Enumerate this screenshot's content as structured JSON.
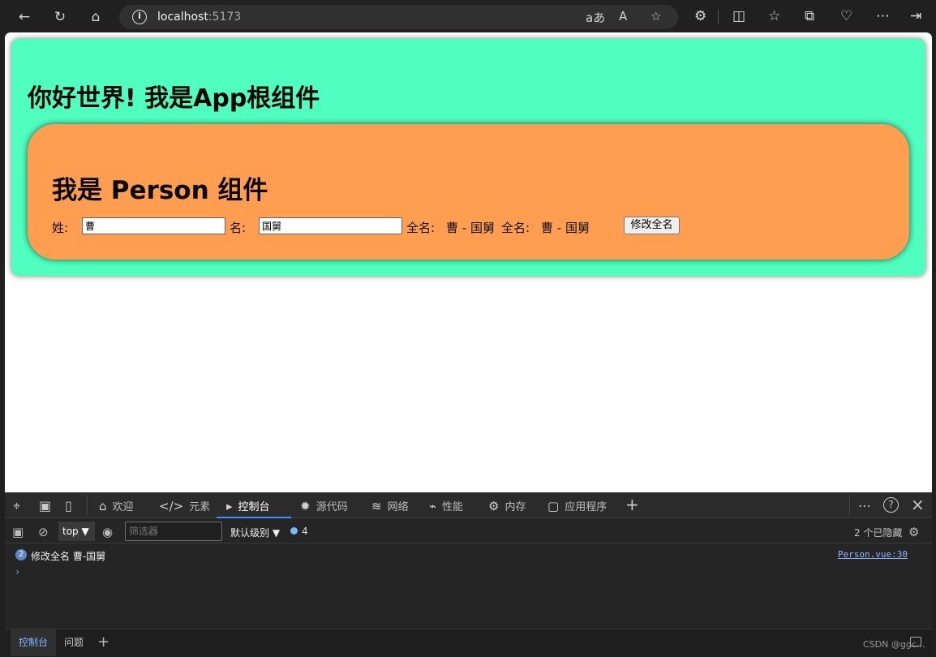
{
  "browser": {
    "back_icon": "←",
    "refresh_icon": "↻",
    "home_icon": "⌂",
    "site_info_icon": "i",
    "address_host": "localhost",
    "address_port": ":5173",
    "read_icon": "aあ",
    "aloud_icon": "A",
    "favorite_icon": "☆",
    "extensions_icon": "⚙",
    "split_icon": "◫",
    "favorites_icon": "☆",
    "collections_icon": "⧉",
    "performance_icon": "♡",
    "more_icon": "⋯",
    "sidebar_icon": "⇥"
  },
  "page": {
    "app_title": "你好世界! 我是App根组件",
    "person_title": "我是 Person 组件",
    "surname_label": "姓:",
    "surname_value": "曹",
    "given_name_label": "名:",
    "given_name_value": "国舅",
    "full_name_label_1": "全名:",
    "full_name_value_1": "曹 - 国舅",
    "full_name_label_2": "全名:",
    "full_name_value_2": "曹 - 国舅",
    "change_full_name_button": "修改全名"
  },
  "devtools": {
    "inspect_icon": "⌖",
    "device_icon": "▣",
    "dock_icon": "▯",
    "tabs": [
      {
        "icon": "⌂",
        "label": "欢迎"
      },
      {
        "icon": "</>",
        "label": "元素"
      },
      {
        "icon": "▸",
        "label": "控制台"
      },
      {
        "icon": "✹",
        "label": "源代码"
      },
      {
        "icon": "≋",
        "label": "网络"
      },
      {
        "icon": "⌁",
        "label": "性能"
      },
      {
        "icon": "⚙",
        "label": "内存"
      },
      {
        "icon": "▢",
        "label": "应用程序"
      }
    ],
    "add_tab_icon": "+",
    "more_icon": "⋯",
    "help_icon": "?",
    "close_icon": "×",
    "sidebar_icon": "▣",
    "clear_icon": "⊘",
    "context": "top",
    "dropdown_icon": "▼",
    "eye_icon": "◉",
    "filter_placeholder": "筛选器",
    "log_level": "默认级别",
    "log_level_icon": "▼",
    "message_count": "4",
    "hidden_count": "2 个已隐藏",
    "settings_icon": "⚙",
    "log_count": "2",
    "log_message": "修改全名 曹-国舅",
    "log_source": "Person.vue:30",
    "prompt_icon": "›",
    "bottom_console_tab": "控制台",
    "bottom_issues_tab": "问题",
    "bottom_add_icon": "+",
    "watermark": "CSDN @ggc..."
  }
}
